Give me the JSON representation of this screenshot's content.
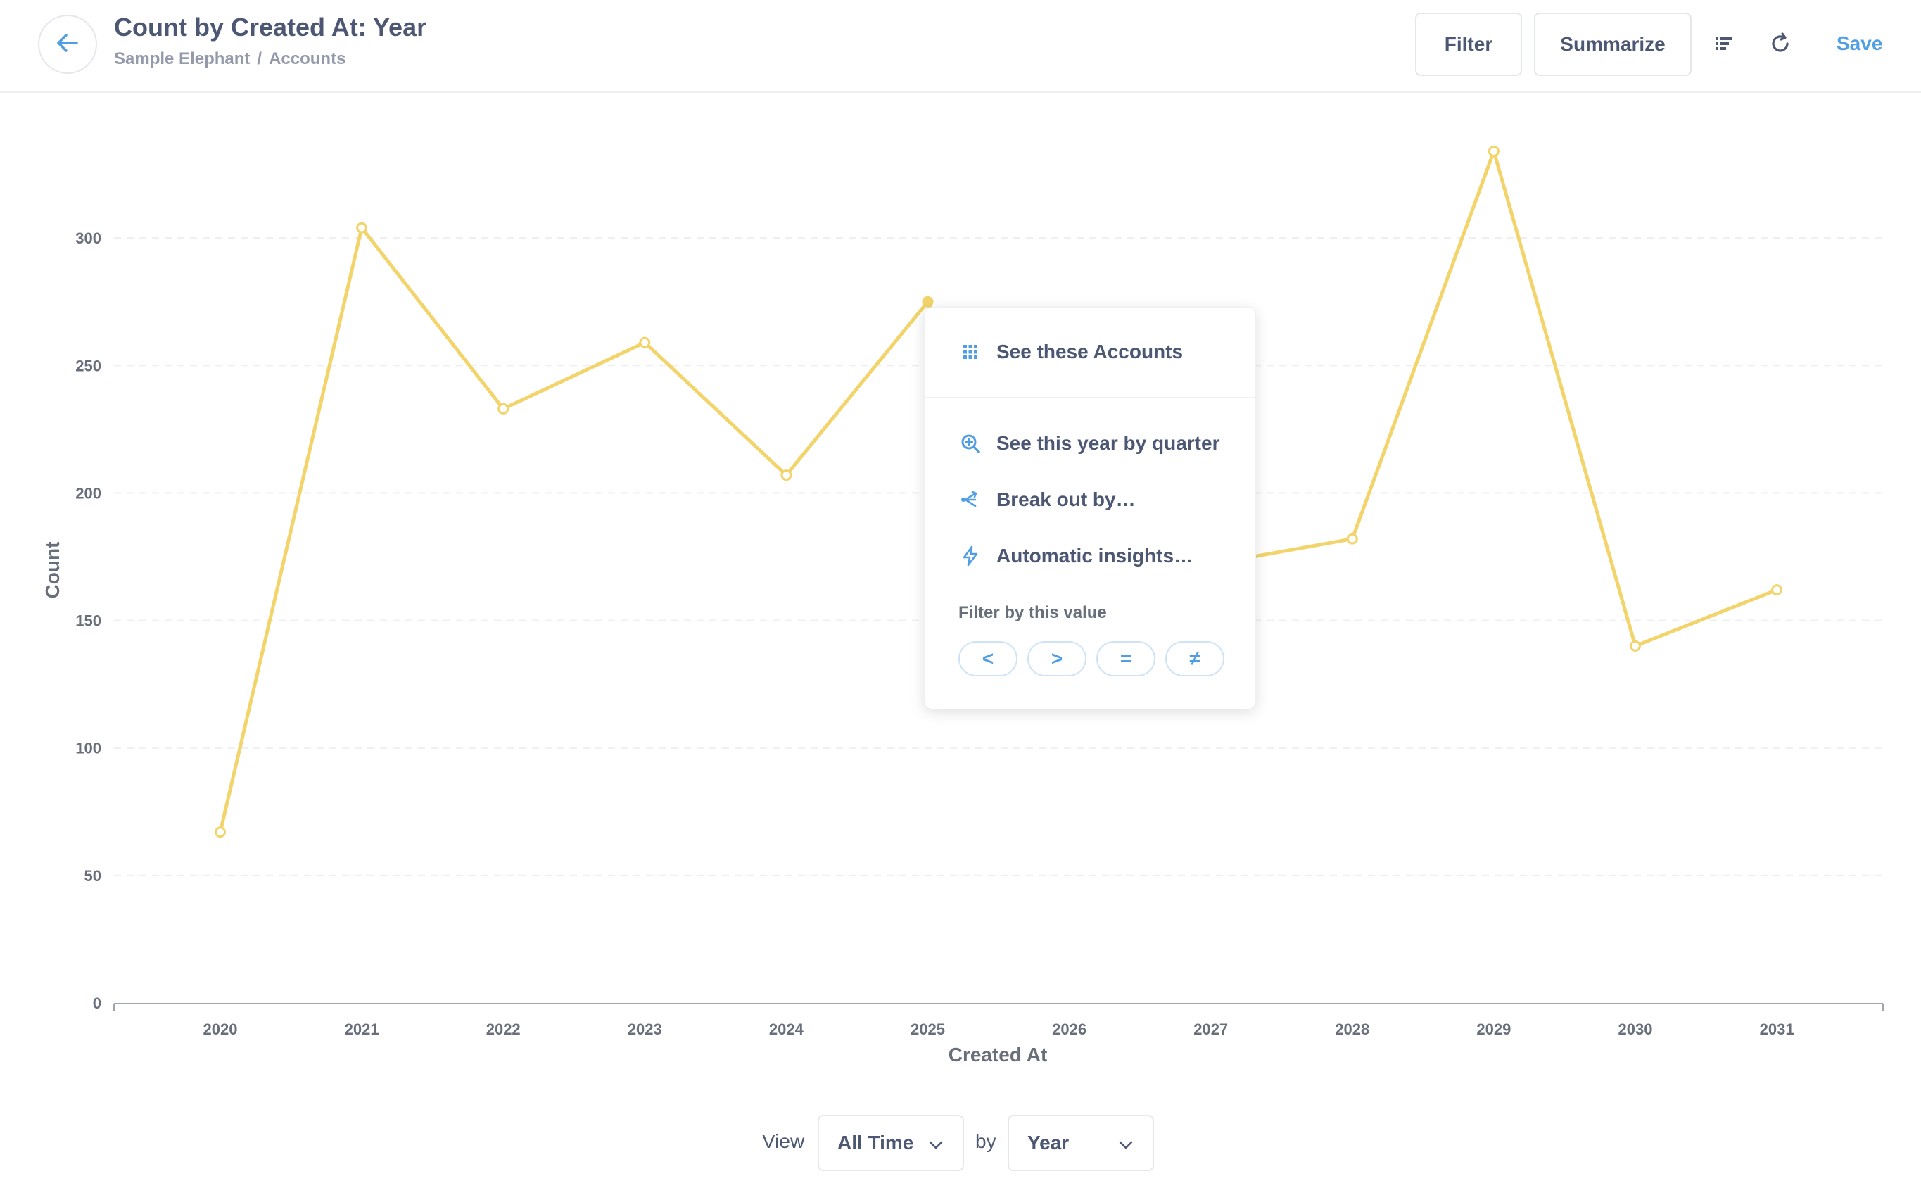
{
  "header": {
    "title": "Count by Created At: Year",
    "breadcrumb": [
      "Sample Elephant",
      "Accounts"
    ],
    "breadcrumb_separator": "/",
    "filter_label": "Filter",
    "summarize_label": "Summarize",
    "save_label": "Save"
  },
  "popover": {
    "see_records": "See these Accounts",
    "zoom": "See this year by quarter",
    "breakout": "Break out by…",
    "insights": "Automatic insights…",
    "filter_label": "Filter by this value",
    "operators": [
      "<",
      ">",
      "=",
      "≠"
    ]
  },
  "footer": {
    "view_label": "View",
    "time_value": "All Time",
    "by_label": "by",
    "unit_value": "Year"
  },
  "colors": {
    "series": "#f2d46b",
    "accent": "#509ee3",
    "text": "#4c5773"
  },
  "chart_data": {
    "type": "line",
    "categories": [
      "2020",
      "2021",
      "2022",
      "2023",
      "2024",
      "2025",
      "2026",
      "2027",
      "2028",
      "2029",
      "2030",
      "2031"
    ],
    "values": [
      67,
      304,
      233,
      259,
      207,
      275,
      168,
      172,
      182,
      334,
      140,
      162
    ],
    "xlabel": "Created At",
    "ylabel": "Count",
    "yticks": [
      0,
      50,
      100,
      150,
      200,
      250,
      300
    ],
    "ylim": [
      0,
      350
    ],
    "grid": true,
    "highlighted_index": 5
  }
}
